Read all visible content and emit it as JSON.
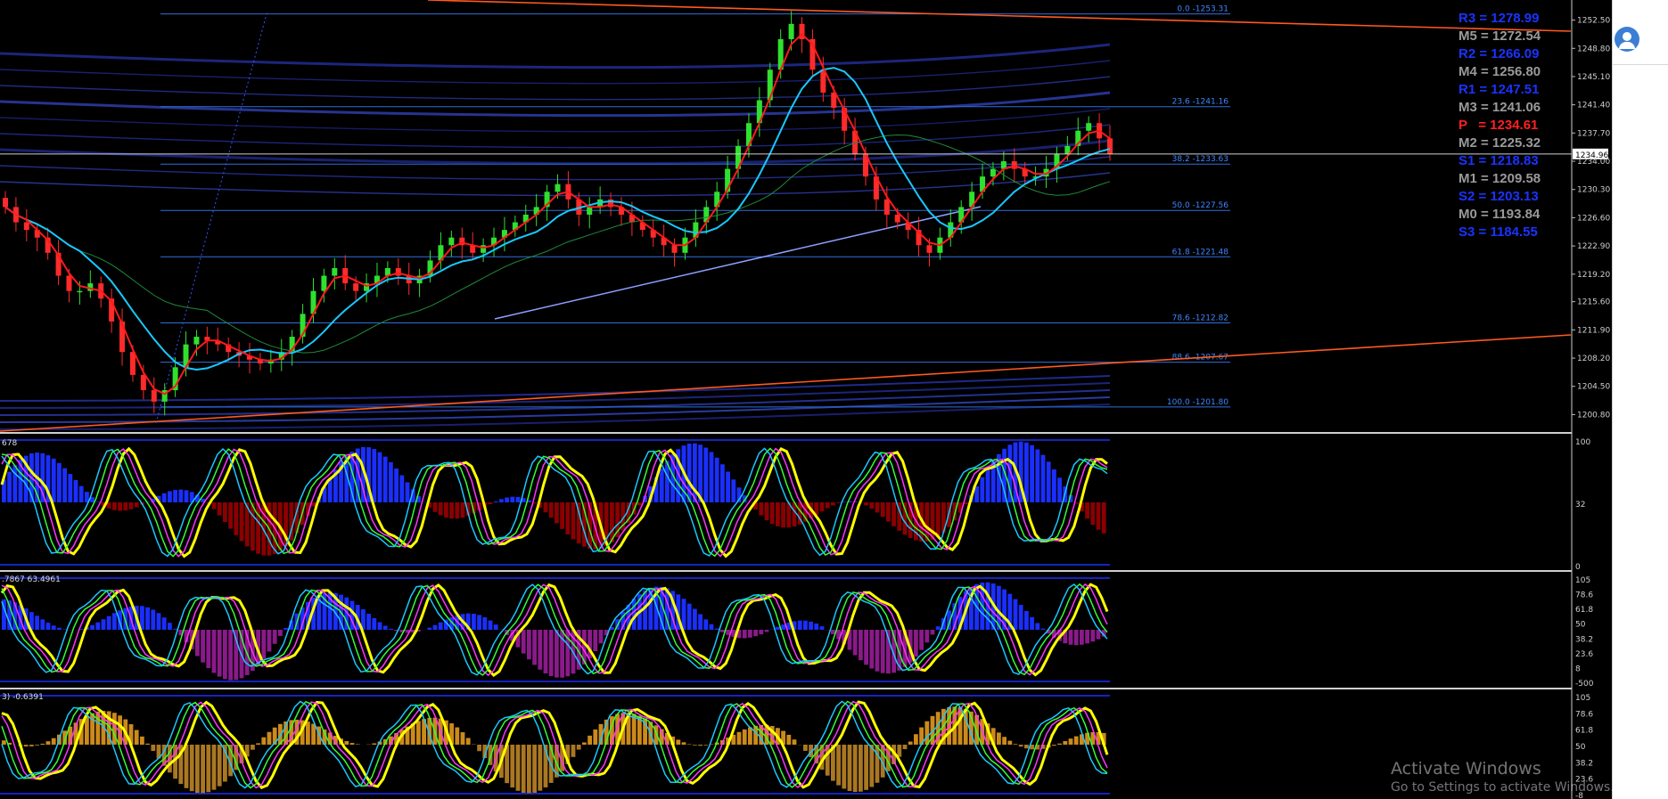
{
  "pivot_levels": [
    {
      "label": "R3 = 1278.99",
      "color": "#1a33ff"
    },
    {
      "label": "M5 = 1272.54",
      "color": "#9a9a9a"
    },
    {
      "label": "R2 = 1266.09",
      "color": "#1a33ff"
    },
    {
      "label": "M4 = 1256.80",
      "color": "#9a9a9a"
    },
    {
      "label": "R1 = 1247.51",
      "color": "#1a33ff"
    },
    {
      "label": "M3 = 1241.06",
      "color": "#9a9a9a"
    },
    {
      "label": "P   = 1234.61",
      "color": "#ff2020"
    },
    {
      "label": "M2 = 1225.32",
      "color": "#9a9a9a"
    },
    {
      "label": "S1 = 1218.83",
      "color": "#1a33ff"
    },
    {
      "label": "M1 = 1209.58",
      "color": "#9a9a9a"
    },
    {
      "label": "S2 = 1203.13",
      "color": "#1a33ff"
    },
    {
      "label": "M0 = 1193.84",
      "color": "#9a9a9a"
    },
    {
      "label": "S3 = 1184.55",
      "color": "#1a33ff"
    }
  ],
  "current_price": "1234.96",
  "panel_labels": {
    "sub1": "678",
    "sub2": ".7867 63.4961",
    "sub3": "3) -0.6391"
  },
  "watermark": {
    "title": "Activate Windows",
    "subtitle": "Go to Settings to activate Windows."
  },
  "colors": {
    "background": "#000000",
    "fib": "#2f6fd8",
    "trendline": "#ff5a1e",
    "bull": "#2fe02f",
    "bear": "#ff2a2a",
    "fast_ma": "#ff1a1a",
    "mid_ma": "#19c8ff",
    "osc_main": "#ffff00",
    "hist_up": "#1a2fff",
    "hist_down_1": "#8b0000",
    "hist_down_2": "#8a1a8a"
  },
  "chart_data": {
    "type": "candlestick",
    "price_axis_ticks": [
      "1252.50",
      "1248.80",
      "1245.10",
      "1241.40",
      "1237.70",
      "1234.00",
      "1230.30",
      "1226.60",
      "1222.90",
      "1219.20",
      "1215.60",
      "1211.90",
      "1208.20",
      "1204.50",
      "1200.80"
    ],
    "price_range": [
      1199.1,
      1254.2
    ],
    "fib_levels": [
      {
        "pct": "0.0",
        "price": 1253.31,
        "label": "0.0 -1253.31"
      },
      {
        "pct": "23.6",
        "price": 1241.16,
        "label": "23.6 -1241.16"
      },
      {
        "pct": "38.2",
        "price": 1233.63,
        "label": "38.2 -1233.63"
      },
      {
        "pct": "50.0",
        "price": 1227.56,
        "label": "50.0 -1227.56"
      },
      {
        "pct": "61.8",
        "price": 1221.48,
        "label": "61.8 -1221.48"
      },
      {
        "pct": "78.6",
        "price": 1212.82,
        "label": "78.6 -1212.82"
      },
      {
        "pct": "88.6",
        "price": 1207.67,
        "label": "88.6 -1207.67"
      },
      {
        "pct": "100.0",
        "price": 1201.8,
        "label": "100.0 -1201.80"
      }
    ],
    "close_path": [
      1228,
      1226,
      1225,
      1224,
      1222,
      1219,
      1217,
      1217,
      1218,
      1216,
      1213,
      1209,
      1206,
      1204,
      1202.5,
      1204,
      1207,
      1210,
      1211,
      1210.5,
      1210,
      1209,
      1208.5,
      1208,
      1207.5,
      1208,
      1209,
      1211,
      1214,
      1217,
      1219,
      1220,
      1218,
      1217,
      1218,
      1219,
      1220,
      1219,
      1218,
      1219,
      1221,
      1223,
      1224,
      1223,
      1222,
      1223,
      1224,
      1225,
      1226,
      1227,
      1228,
      1230,
      1231,
      1229,
      1227,
      1228,
      1229,
      1228,
      1227,
      1226,
      1225,
      1224,
      1223,
      1222,
      1224,
      1226,
      1228,
      1230,
      1233,
      1236,
      1239,
      1242,
      1246,
      1250,
      1252,
      1250,
      1246,
      1243,
      1241,
      1238,
      1235,
      1232,
      1229,
      1227,
      1226,
      1225,
      1223,
      1222,
      1224,
      1226,
      1228,
      1230,
      1232,
      1233,
      1234,
      1233,
      1232,
      1232,
      1233,
      1235,
      1236,
      1238,
      1239,
      1237,
      1234.96
    ],
    "sub1_axis": [
      "100",
      "32",
      "0"
    ],
    "sub2_axis": [
      "105",
      "78.6",
      "61.8",
      "50",
      "38.2",
      "23.6",
      "8",
      "-500"
    ],
    "sub3_axis": [
      "105",
      "78.6",
      "61.8",
      "50",
      "38.2",
      "23.6",
      "-8"
    ]
  }
}
